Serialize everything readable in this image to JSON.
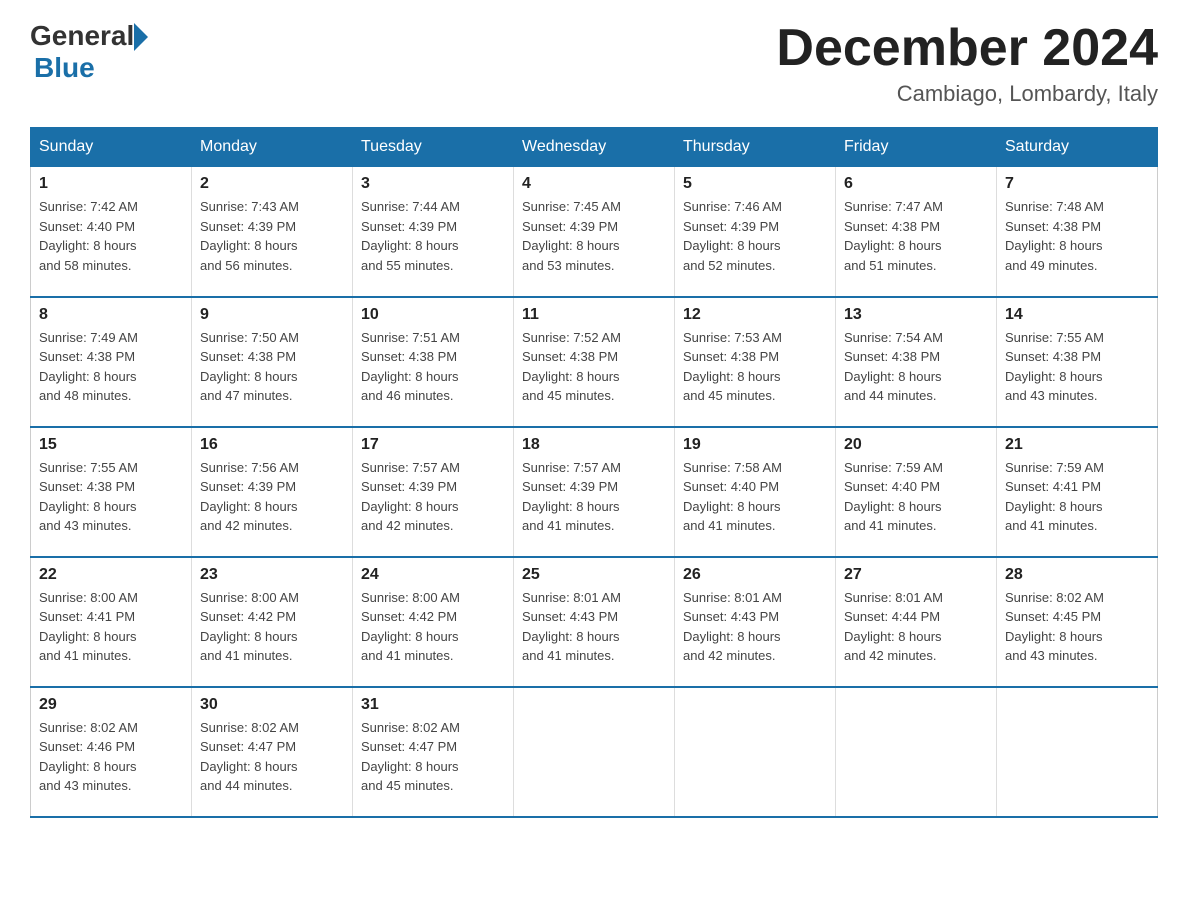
{
  "logo": {
    "text_general": "General",
    "text_blue": "Blue"
  },
  "title": "December 2024",
  "location": "Cambiago, Lombardy, Italy",
  "days_of_week": [
    "Sunday",
    "Monday",
    "Tuesday",
    "Wednesday",
    "Thursday",
    "Friday",
    "Saturday"
  ],
  "weeks": [
    [
      {
        "day": "1",
        "sunrise": "7:42 AM",
        "sunset": "4:40 PM",
        "daylight": "8 hours and 58 minutes."
      },
      {
        "day": "2",
        "sunrise": "7:43 AM",
        "sunset": "4:39 PM",
        "daylight": "8 hours and 56 minutes."
      },
      {
        "day": "3",
        "sunrise": "7:44 AM",
        "sunset": "4:39 PM",
        "daylight": "8 hours and 55 minutes."
      },
      {
        "day": "4",
        "sunrise": "7:45 AM",
        "sunset": "4:39 PM",
        "daylight": "8 hours and 53 minutes."
      },
      {
        "day": "5",
        "sunrise": "7:46 AM",
        "sunset": "4:39 PM",
        "daylight": "8 hours and 52 minutes."
      },
      {
        "day": "6",
        "sunrise": "7:47 AM",
        "sunset": "4:38 PM",
        "daylight": "8 hours and 51 minutes."
      },
      {
        "day": "7",
        "sunrise": "7:48 AM",
        "sunset": "4:38 PM",
        "daylight": "8 hours and 49 minutes."
      }
    ],
    [
      {
        "day": "8",
        "sunrise": "7:49 AM",
        "sunset": "4:38 PM",
        "daylight": "8 hours and 48 minutes."
      },
      {
        "day": "9",
        "sunrise": "7:50 AM",
        "sunset": "4:38 PM",
        "daylight": "8 hours and 47 minutes."
      },
      {
        "day": "10",
        "sunrise": "7:51 AM",
        "sunset": "4:38 PM",
        "daylight": "8 hours and 46 minutes."
      },
      {
        "day": "11",
        "sunrise": "7:52 AM",
        "sunset": "4:38 PM",
        "daylight": "8 hours and 45 minutes."
      },
      {
        "day": "12",
        "sunrise": "7:53 AM",
        "sunset": "4:38 PM",
        "daylight": "8 hours and 45 minutes."
      },
      {
        "day": "13",
        "sunrise": "7:54 AM",
        "sunset": "4:38 PM",
        "daylight": "8 hours and 44 minutes."
      },
      {
        "day": "14",
        "sunrise": "7:55 AM",
        "sunset": "4:38 PM",
        "daylight": "8 hours and 43 minutes."
      }
    ],
    [
      {
        "day": "15",
        "sunrise": "7:55 AM",
        "sunset": "4:38 PM",
        "daylight": "8 hours and 43 minutes."
      },
      {
        "day": "16",
        "sunrise": "7:56 AM",
        "sunset": "4:39 PM",
        "daylight": "8 hours and 42 minutes."
      },
      {
        "day": "17",
        "sunrise": "7:57 AM",
        "sunset": "4:39 PM",
        "daylight": "8 hours and 42 minutes."
      },
      {
        "day": "18",
        "sunrise": "7:57 AM",
        "sunset": "4:39 PM",
        "daylight": "8 hours and 41 minutes."
      },
      {
        "day": "19",
        "sunrise": "7:58 AM",
        "sunset": "4:40 PM",
        "daylight": "8 hours and 41 minutes."
      },
      {
        "day": "20",
        "sunrise": "7:59 AM",
        "sunset": "4:40 PM",
        "daylight": "8 hours and 41 minutes."
      },
      {
        "day": "21",
        "sunrise": "7:59 AM",
        "sunset": "4:41 PM",
        "daylight": "8 hours and 41 minutes."
      }
    ],
    [
      {
        "day": "22",
        "sunrise": "8:00 AM",
        "sunset": "4:41 PM",
        "daylight": "8 hours and 41 minutes."
      },
      {
        "day": "23",
        "sunrise": "8:00 AM",
        "sunset": "4:42 PM",
        "daylight": "8 hours and 41 minutes."
      },
      {
        "day": "24",
        "sunrise": "8:00 AM",
        "sunset": "4:42 PM",
        "daylight": "8 hours and 41 minutes."
      },
      {
        "day": "25",
        "sunrise": "8:01 AM",
        "sunset": "4:43 PM",
        "daylight": "8 hours and 41 minutes."
      },
      {
        "day": "26",
        "sunrise": "8:01 AM",
        "sunset": "4:43 PM",
        "daylight": "8 hours and 42 minutes."
      },
      {
        "day": "27",
        "sunrise": "8:01 AM",
        "sunset": "4:44 PM",
        "daylight": "8 hours and 42 minutes."
      },
      {
        "day": "28",
        "sunrise": "8:02 AM",
        "sunset": "4:45 PM",
        "daylight": "8 hours and 43 minutes."
      }
    ],
    [
      {
        "day": "29",
        "sunrise": "8:02 AM",
        "sunset": "4:46 PM",
        "daylight": "8 hours and 43 minutes."
      },
      {
        "day": "30",
        "sunrise": "8:02 AM",
        "sunset": "4:47 PM",
        "daylight": "8 hours and 44 minutes."
      },
      {
        "day": "31",
        "sunrise": "8:02 AM",
        "sunset": "4:47 PM",
        "daylight": "8 hours and 45 minutes."
      },
      null,
      null,
      null,
      null
    ]
  ],
  "labels": {
    "sunrise": "Sunrise:",
    "sunset": "Sunset:",
    "daylight": "Daylight:"
  }
}
